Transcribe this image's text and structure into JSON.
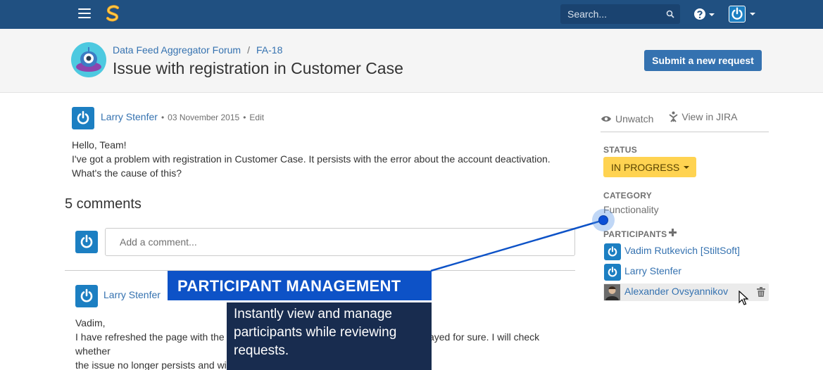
{
  "nav": {
    "search_placeholder": "Search...",
    "colors": {
      "bar": "#205081",
      "search_bg": "#1a4370"
    }
  },
  "header": {
    "breadcrumb": [
      "Data Feed Aggregator Forum",
      "FA-18"
    ],
    "breadcrumb_separator": "/",
    "title": "Issue with registration in Customer Case",
    "submit_label": "Submit a new request"
  },
  "post": {
    "author": "Larry Stenfer",
    "date": "03 November 2015",
    "edit_label": "Edit",
    "lines": [
      "Hello, Team!",
      "I've got a problem with registration in Customer Case. It persists with the error about the account deactivation.",
      "What's the cause of this?"
    ]
  },
  "comments": {
    "title": "5 comments",
    "placeholder": "Add a comment...",
    "first": {
      "author": "Larry Stenfer",
      "lines": [
        "Vadim,",
        "I have refreshed the page with the error again, and I can see the the error is displayed for sure. I will check whether",
        "the issue no longer persists and will let you know."
      ]
    }
  },
  "sidebar": {
    "unwatch_label": "Unwatch",
    "jira_label": "View in JIRA",
    "status_label": "STATUS",
    "status_value": "IN PROGRESS",
    "category_label": "CATEGORY",
    "category_value": "Functionality",
    "participants_label": "PARTICIPANTS",
    "participants": [
      {
        "name": "Vadim Rutkevich [StiltSoft]"
      },
      {
        "name": "Larry Stenfer"
      },
      {
        "name": "Alexander Ovsyannikov"
      }
    ],
    "colors": {
      "status_bg": "#ffd351",
      "link": "#3572b0"
    }
  },
  "callout": {
    "heading": "PARTICIPANT MANAGEMENT",
    "body": "Instantly view and manage participants while reviewing requests.",
    "colors": {
      "heading_bg": "#0d52c7",
      "body_bg": "#182c4f"
    }
  },
  "icons": [
    "menu-icon",
    "app-logo-icon",
    "search-icon",
    "help-icon",
    "user-avatar-icon",
    "eye-icon",
    "jira-icon",
    "plus-icon",
    "trash-icon",
    "cursor-icon"
  ]
}
